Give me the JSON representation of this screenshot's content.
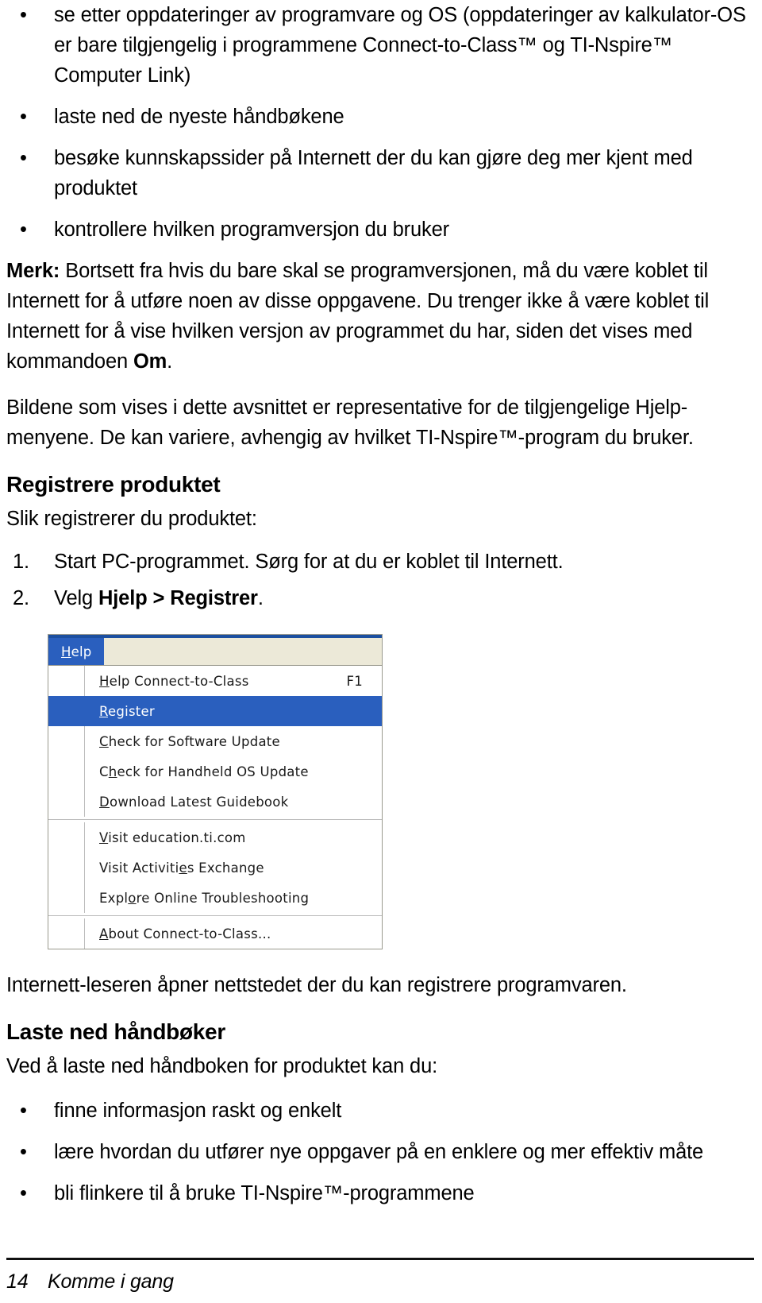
{
  "document": {
    "language": "Norwegian",
    "top_bullets": [
      "se etter oppdateringer av programvare og OS (oppdateringer av kalkulator-OS er bare tilgjengelig i programmene Connect-to-Class™ og TI-Nspire™ Computer Link)",
      "laste ned de nyeste håndbøkene",
      "besøke kunnskapssider på Internett der du kan gjøre deg mer kjent med produktet",
      "kontrollere hvilken programversjon du bruker"
    ],
    "note": {
      "label": "Merk:",
      "text_before_om": " Bortsett fra hvis du bare skal se programversjonen, må du være koblet til Internett for å utføre noen av disse oppgavene. Du trenger ikke å være koblet til Internett for å vise hvilken versjon av programmet du har, siden det vises med kommandoen ",
      "om_bold": "Om",
      "text_after_om": "."
    },
    "images_paragraph": "Bildene som vises i dette avsnittet er representative for de tilgjengelige Hjelp-menyene. De kan variere, avhengig av hvilket TI-Nspire™-program du bruker.",
    "register_section": {
      "heading": "Registrere produktet",
      "intro": "Slik registrerer du produktet:",
      "steps": [
        {
          "number": "1.",
          "text": "Start PC-programmet. Sørg for at du er koblet til Internett.",
          "bold_parts": []
        },
        {
          "number": "2.",
          "prefix": "Velg ",
          "bold_1": "Hjelp",
          "middle": " > ",
          "bold_2": "Registrer",
          "suffix": "."
        }
      ],
      "after_image_text": "Internett-leseren åpner nettstedet der du kan registrere programvaren."
    },
    "guidebook_section": {
      "heading": "Laste ned håndbøker",
      "intro": "Ved å laste ned håndboken for produktet kan du:",
      "bullets": [
        "finne informasjon raskt og enkelt",
        "lære hvordan du utfører nye oppgaver på en enklere og mer effektiv måte",
        "bli flinkere til å bruke TI-Nspire™-programmene"
      ]
    },
    "footer": {
      "page_number": "14",
      "chapter": "Komme i gang"
    }
  },
  "menu_screenshot": {
    "menubar": {
      "item_mnemonic": "H",
      "item_rest": "elp"
    },
    "items": [
      {
        "mnemonic": "H",
        "rest": "elp Connect-to-Class",
        "accel": "F1",
        "selected": false
      },
      {
        "mnemonic": "R",
        "rest": "egister",
        "accel": "",
        "selected": true
      },
      {
        "mnemonic": "C",
        "rest": "heck for Software Update",
        "accel": "",
        "selected": false,
        "mnemonic_offset": 0
      },
      {
        "mnemonic_pre": "C",
        "mnemonic": "h",
        "rest": "eck for Handheld OS Update",
        "accel": "",
        "selected": false
      },
      {
        "mnemonic": "D",
        "rest": "ownload Latest Guidebook",
        "accel": "",
        "selected": false
      },
      {
        "mnemonic": "V",
        "rest": "isit education.ti.com",
        "accel": "",
        "selected": false
      },
      {
        "mnemonic_pre": "Visit Activiti",
        "mnemonic": "e",
        "rest": "s Exchange",
        "accel": "",
        "selected": false
      },
      {
        "mnemonic_pre": "Expl",
        "mnemonic": "o",
        "rest": "re Online Troubleshooting",
        "accel": "",
        "selected": false
      },
      {
        "mnemonic": "A",
        "rest": "bout Connect-to-Class...",
        "accel": "",
        "selected": false
      }
    ],
    "separator_after_indices": [
      4,
      7
    ],
    "colors": {
      "menubar_background": "#ece9d8",
      "menubar_item": "#2a5fbe",
      "highlight": "#2a5fbe",
      "highlight_text": "#ffffff",
      "border": "#9a9a8e",
      "top_strip": "#1b4fa0"
    }
  }
}
